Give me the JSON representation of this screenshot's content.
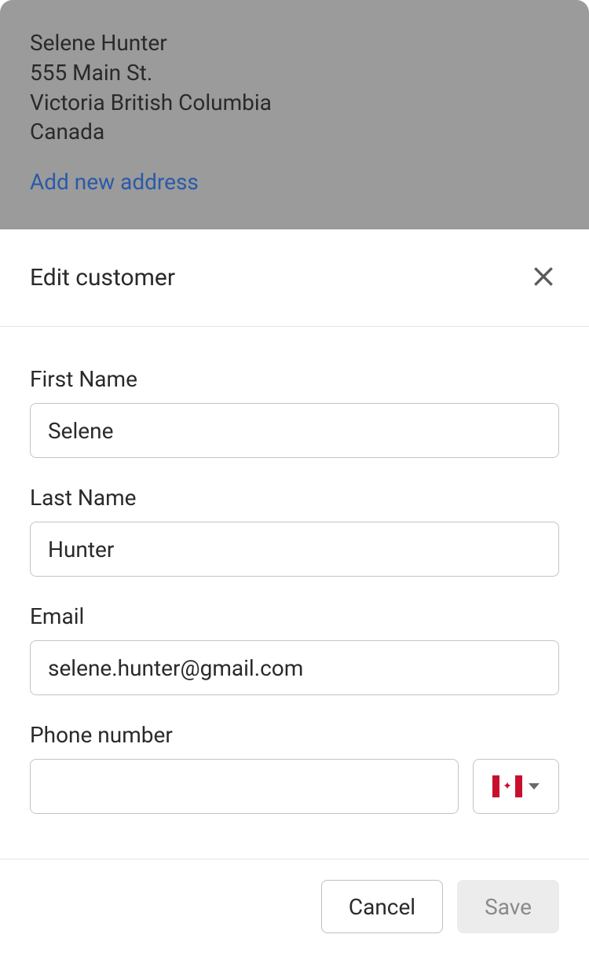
{
  "background": {
    "name": "Selene Hunter",
    "street": "555 Main St.",
    "city_province": "Victoria British Columbia",
    "country": "Canada",
    "add_address_label": "Add new address"
  },
  "modal": {
    "title": "Edit customer",
    "fields": {
      "first_name": {
        "label": "First Name",
        "value": "Selene"
      },
      "last_name": {
        "label": "Last Name",
        "value": "Hunter"
      },
      "email": {
        "label": "Email",
        "value": "selene.hunter@gmail.com"
      },
      "phone": {
        "label": "Phone number",
        "value": "",
        "country": "Canada"
      }
    },
    "actions": {
      "cancel": "Cancel",
      "save": "Save"
    }
  }
}
